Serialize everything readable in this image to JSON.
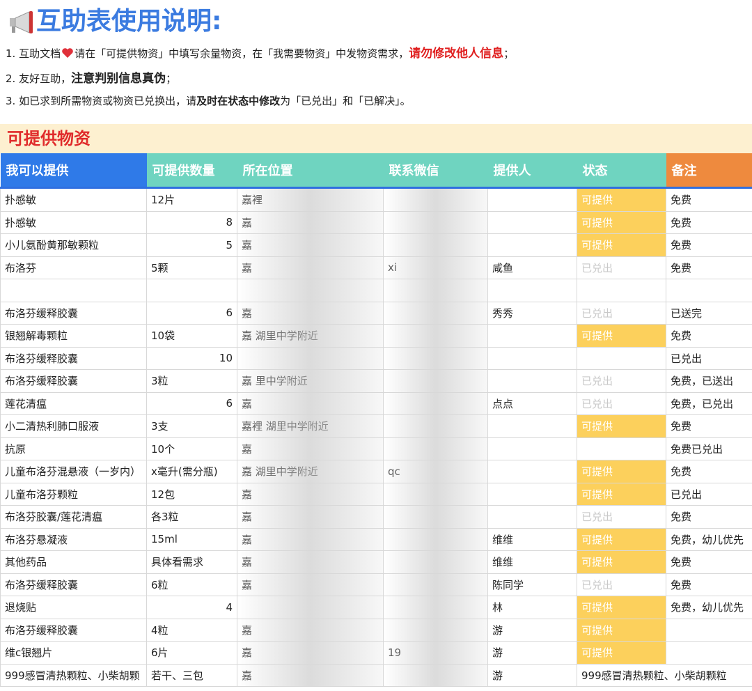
{
  "title": "互助表使用说明:",
  "icons": {
    "horn": "megaphone-icon",
    "heart": "heart-icon"
  },
  "notes": {
    "n1": {
      "a": "1. 互助文档",
      "b": "请在「可提供物资」中填写余量物资，在「我需要物资」中发物资需求，",
      "red": "请勿修改他人信息",
      "c": "；"
    },
    "n2": {
      "a": "2. 友好互助，",
      "bold": "注意判别信息真伪",
      "c": "；"
    },
    "n3": {
      "a": "3. 如已求到所需物资或物资已兑换出，请",
      "bold": "及时在状态中修改",
      "c": "为「已兑出」和「已解决」。"
    }
  },
  "section_title": "可提供物资",
  "columns": [
    "我可以提供",
    "可提供数量",
    "所在位置",
    "联系微信",
    "提供人",
    "状态",
    "备注"
  ],
  "rows": [
    {
      "item": "扑感敏",
      "qty": "12片",
      "qty_num": false,
      "loc": "嘉裡",
      "wx": "",
      "person": "",
      "status": "可提供",
      "note": "免费"
    },
    {
      "item": "扑感敏",
      "qty": "8",
      "qty_num": true,
      "loc": "嘉",
      "wx": "",
      "person": "",
      "status": "可提供",
      "note": "免费"
    },
    {
      "item": "小儿氨酚黄那敏颗粒",
      "qty": "5",
      "qty_num": true,
      "loc": "嘉",
      "wx": "",
      "person": "",
      "status": "可提供",
      "note": "免费"
    },
    {
      "item": "布洛芬",
      "qty": "5颗",
      "qty_num": false,
      "loc": "嘉",
      "wx": "xi",
      "person": "咸鱼",
      "status": "已兑出",
      "note": "免费"
    },
    {
      "item": "",
      "qty": "",
      "qty_num": false,
      "loc": "",
      "wx": "",
      "person": "",
      "status": "",
      "note": ""
    },
    {
      "item": "布洛芬缓释胶囊",
      "qty": "6",
      "qty_num": true,
      "loc": "嘉",
      "wx": "",
      "person": "秀秀",
      "status": "已兑出",
      "note": "已送完"
    },
    {
      "item": "银翘解毒颗粒",
      "qty": "10袋",
      "qty_num": false,
      "loc": "嘉 湖里中学附近",
      "wx": "",
      "person": "",
      "status": "可提供",
      "note": "免费"
    },
    {
      "item": "布洛芬缓释胶囊",
      "qty": "10",
      "qty_num": true,
      "loc": "",
      "wx": "",
      "person": "",
      "status": "",
      "note": "已兑出"
    },
    {
      "item": "布洛芬缓释胶囊",
      "qty": "3粒",
      "qty_num": false,
      "loc": "嘉 里中学附近",
      "wx": "",
      "person": "",
      "status": "已兑出",
      "note": "免费，已送出"
    },
    {
      "item": "莲花清瘟",
      "qty": "6",
      "qty_num": true,
      "loc": "嘉",
      "wx": "",
      "person": "点点",
      "status": "已兑出",
      "note": "免费，已兑出"
    },
    {
      "item": "小二清热利肺口服液",
      "qty": "3支",
      "qty_num": false,
      "loc": "嘉裡 湖里中学附近",
      "wx": "",
      "person": "",
      "status": "可提供",
      "note": "免费"
    },
    {
      "item": "抗原",
      "qty": "10个",
      "qty_num": false,
      "loc": "嘉",
      "wx": "",
      "person": "",
      "status": "",
      "note": "免费已兑出"
    },
    {
      "item": "儿童布洛芬混悬液（一岁内）",
      "qty": "x毫升(需分瓶)",
      "qty_num": false,
      "loc": "嘉 湖里中学附近",
      "wx": "qc",
      "person": "",
      "status": "可提供",
      "note": "免费"
    },
    {
      "item": "儿童布洛芬颗粒",
      "qty": "12包",
      "qty_num": false,
      "loc": "嘉",
      "wx": "",
      "person": "",
      "status": "可提供",
      "note": "已兑出"
    },
    {
      "item": "布洛芬胶囊/莲花清瘟",
      "qty": "各3粒",
      "qty_num": false,
      "loc": "嘉",
      "wx": "",
      "person": "",
      "status": "已兑出",
      "note": "免费"
    },
    {
      "item": "布洛芬悬凝液",
      "qty": "15ml",
      "qty_num": false,
      "loc": "嘉",
      "wx": "",
      "person": "维维",
      "status": "可提供",
      "note": "免费，幼儿优先"
    },
    {
      "item": "其他药品",
      "qty": "具体看需求",
      "qty_num": false,
      "loc": "嘉",
      "wx": "",
      "person": "维维",
      "status": "可提供",
      "note": "免费"
    },
    {
      "item": "布洛芬缓释胶囊",
      "qty": "6粒",
      "qty_num": false,
      "loc": "嘉",
      "wx": "",
      "person": "陈同学",
      "status": "已兑出",
      "note": "免费"
    },
    {
      "item": "退烧贴",
      "qty": "4",
      "qty_num": true,
      "loc": "",
      "wx": "",
      "person": "林",
      "status": "可提供",
      "note": "免费，幼儿优先"
    },
    {
      "item": "布洛芬缓释胶囊",
      "qty": "4粒",
      "qty_num": false,
      "loc": "嘉",
      "wx": "",
      "person": "游",
      "status": "可提供",
      "note": ""
    },
    {
      "item": "维c银翘片",
      "qty": "6片",
      "qty_num": false,
      "loc": "嘉",
      "wx": "19",
      "person": "游",
      "status": "可提供",
      "note": ""
    },
    {
      "item": "999感冒清热颗粒、小柴胡颗",
      "qty": "若干、三包",
      "qty_num": false,
      "loc": "嘉",
      "wx": "",
      "person": "游",
      "status": "999感冒清热颗粒、小柴胡颗粒",
      "note": ""
    }
  ],
  "colors": {
    "title": "#3b7be0",
    "red": "#e02020",
    "available": "#fcd05c",
    "header_blue": "#2f7ae8",
    "header_teal": "#6fd4c0",
    "header_orange": "#ee8a3e",
    "banner": "#fdf0d0"
  }
}
